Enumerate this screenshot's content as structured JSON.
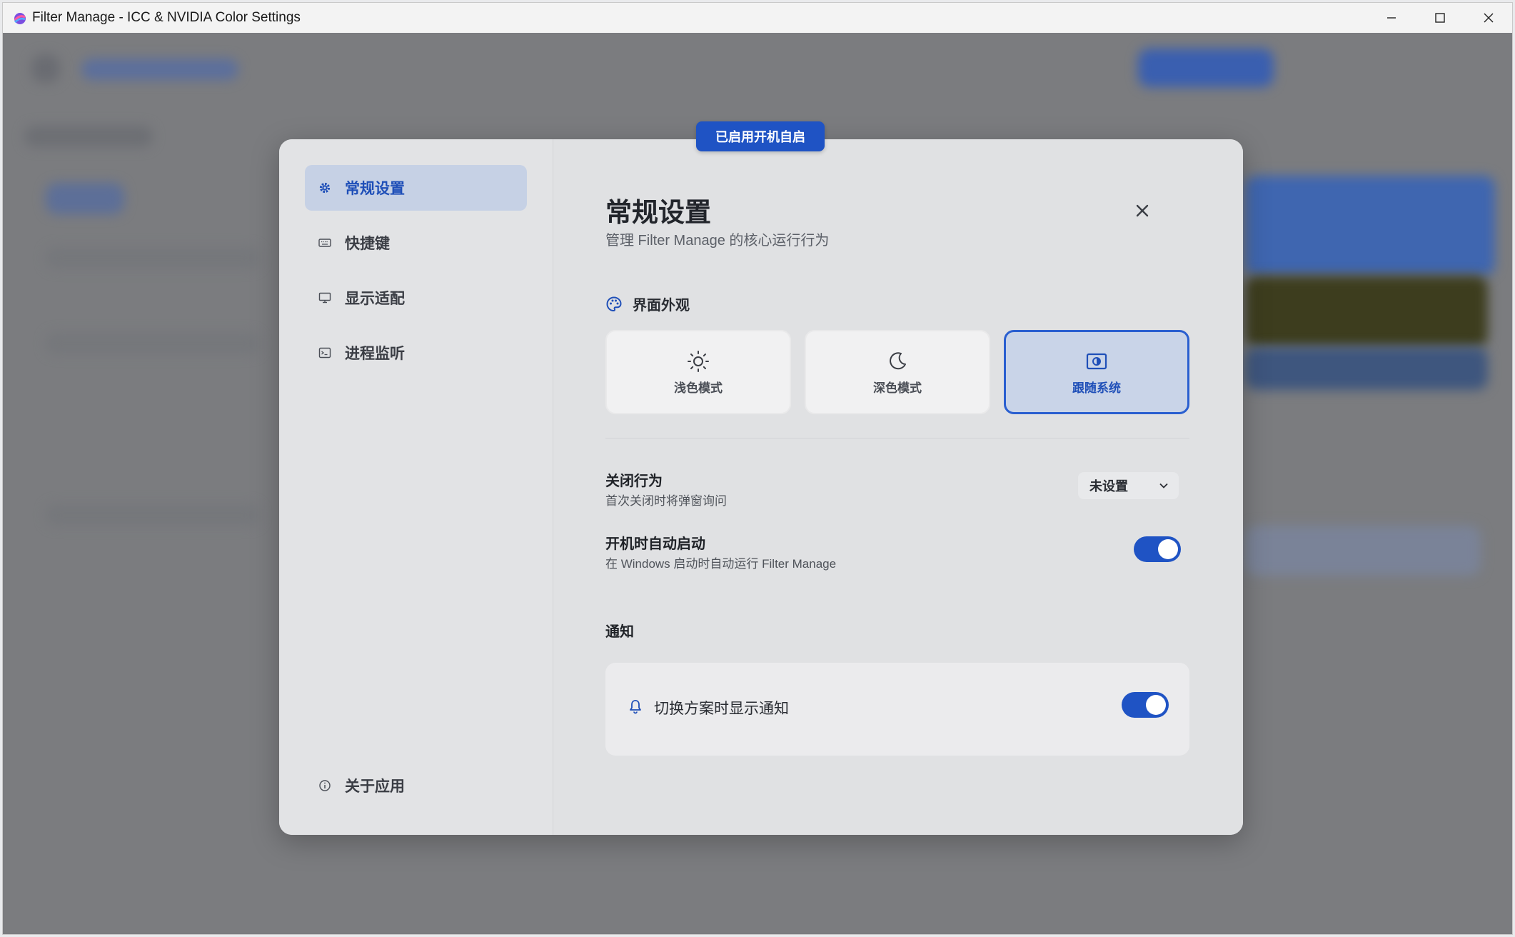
{
  "window": {
    "title": "Filter Manage - ICC & NVIDIA Color Settings"
  },
  "badge": {
    "text": "已启用开机自启"
  },
  "sidebar": {
    "items": [
      {
        "label": "常规设置",
        "icon": "gear-icon",
        "active": true
      },
      {
        "label": "快捷键",
        "icon": "keyboard-icon",
        "active": false
      },
      {
        "label": "显示适配",
        "icon": "monitor-icon",
        "active": false
      },
      {
        "label": "进程监听",
        "icon": "terminal-icon",
        "active": false
      }
    ],
    "about": {
      "label": "关于应用",
      "icon": "info-icon"
    }
  },
  "main": {
    "title": "常规设置",
    "subtitle": "管理 Filter Manage 的核心运行行为",
    "appearance": {
      "header": "界面外观",
      "icon": "palette-icon",
      "options": [
        {
          "label": "浅色模式",
          "icon": "sun-icon",
          "selected": false
        },
        {
          "label": "深色模式",
          "icon": "moon-icon",
          "selected": false
        },
        {
          "label": "跟随系统",
          "icon": "system-theme-icon",
          "selected": true
        }
      ]
    },
    "close_behavior": {
      "title": "关闭行为",
      "desc": "首次关闭时将弹窗询问",
      "value": "未设置"
    },
    "autostart": {
      "title": "开机时自动启动",
      "desc": "在 Windows 启动时自动运行 Filter Manage",
      "enabled": true
    },
    "notifications": {
      "header": "通知",
      "item_label": "切换方案时显示通知",
      "icon": "bell-icon",
      "enabled": true
    }
  },
  "colors": {
    "accent": "#1f53c4",
    "accent_text": "#1f4fb8",
    "selected_bg": "#c6d1e5"
  }
}
